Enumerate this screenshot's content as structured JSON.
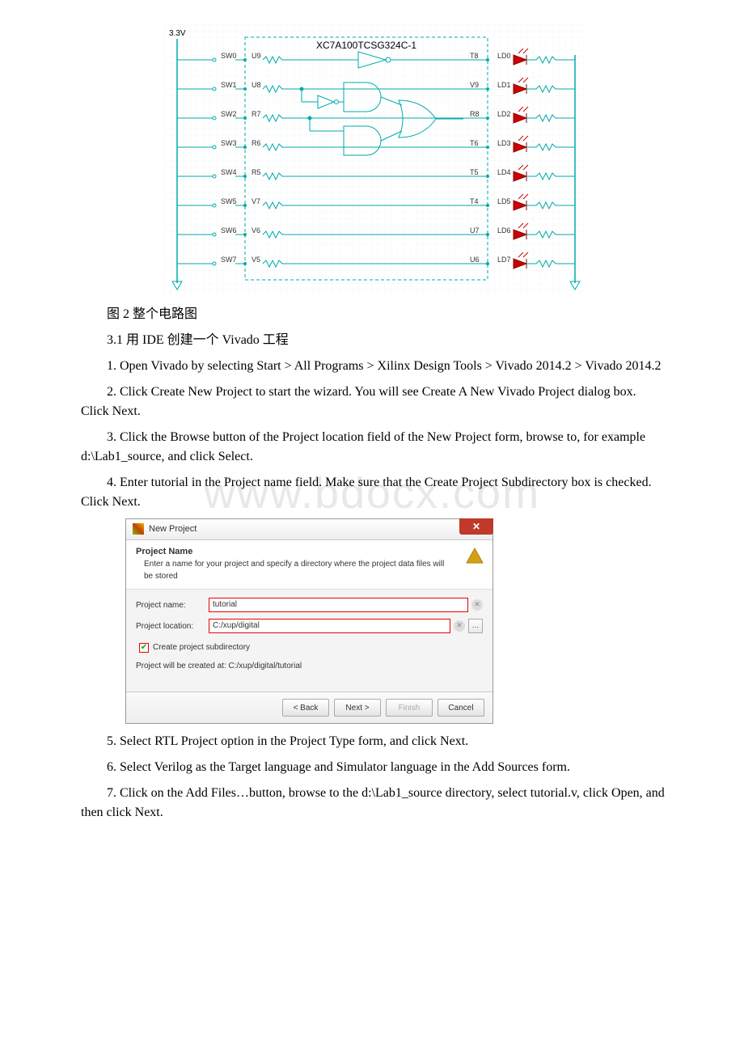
{
  "watermark": "www.bdocx.com",
  "circuit": {
    "voltage": "3.3V",
    "chip_label": "XC7A100TCSG324C-1",
    "switches": [
      "SW0",
      "SW1",
      "SW2",
      "SW3",
      "SW4",
      "SW5",
      "SW6",
      "SW7"
    ],
    "sw_pins": [
      "U9",
      "U8",
      "R7",
      "R6",
      "R5",
      "V7",
      "V6",
      "V5"
    ],
    "out_pins": [
      "T8",
      "V9",
      "R8",
      "T6",
      "T5",
      "T4",
      "U7",
      "U6"
    ],
    "leds": [
      "LD0",
      "LD1",
      "LD2",
      "LD3",
      "LD4",
      "LD5",
      "LD6",
      "LD7"
    ]
  },
  "text": {
    "caption": "图 2 整个电路图",
    "section": "3.1 用 IDE 创建一个 Vivado 工程",
    "p1": "1. Open Vivado by selecting Start > All Programs > Xilinx Design Tools > Vivado 2014.2 > Vivado 2014.2",
    "p2": "2. Click Create New Project to start the wizard. You will see Create A New Vivado Project dialog box. Click Next.",
    "p3": "3. Click the Browse button of the Project location field of the New Project form, browse to, for example d:\\Lab1_source, and click Select.",
    "p4": "4. Enter tutorial in the Project name field. Make sure that the Create Project Subdirectory box is checked. Click Next.",
    "p5": "5. Select RTL Project option in the Project Type form, and click Next.",
    "p6": "6. Select Verilog as the Target language and Simulator language in the Add Sources form.",
    "p7": "7. Click on the Add Files…button, browse to the d:\\Lab1_source directory, select tutorial.v, click Open, and then click Next."
  },
  "dialog": {
    "title": "New Project",
    "hdr_title": "Project Name",
    "hdr_desc": "Enter a name for your project and specify a directory where the project data files will be stored",
    "name_label": "Project name:",
    "name_value": "tutorial",
    "loc_label": "Project location:",
    "loc_value": "C:/xup/digital",
    "cbx_label": "Create project subdirectory",
    "created_at": "Project will be created at: C:/xup/digital/tutorial",
    "back": "< Back",
    "next": "Next >",
    "finish": "Finish",
    "cancel": "Cancel"
  }
}
